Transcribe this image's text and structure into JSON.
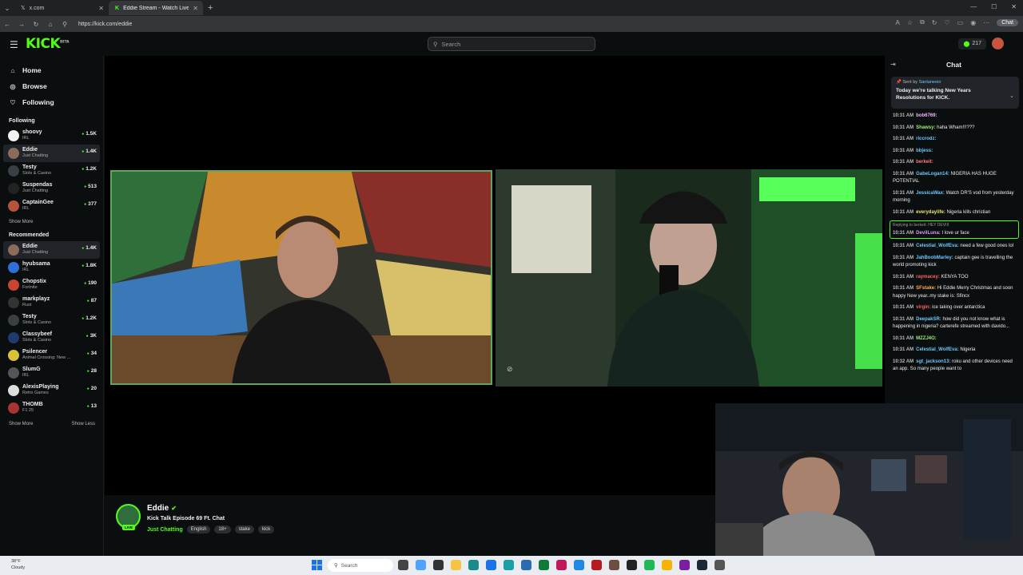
{
  "browser": {
    "tabs": [
      {
        "label": "x.com",
        "active": false
      },
      {
        "label": "Eddie Stream - Watch Live on",
        "active": true
      }
    ],
    "url": "https://kick.com/eddie",
    "chat_pill": "Chat"
  },
  "header": {
    "logo": "KICK",
    "logo_sup": "BETA",
    "search_placeholder": "Search",
    "viewer_count": "217"
  },
  "sidebar": {
    "nav": [
      {
        "label": "Home",
        "icon": "home-icon"
      },
      {
        "label": "Browse",
        "icon": "compass-icon"
      },
      {
        "label": "Following",
        "icon": "heart-icon"
      }
    ],
    "following_title": "Following",
    "following": [
      {
        "name": "shoovy",
        "category": "IRL",
        "viewers": "1.5K",
        "color": "#f2f2f2"
      },
      {
        "name": "Eddie",
        "category": "Just Chatting",
        "viewers": "1.4K",
        "color": "#8a6b5c",
        "selected": true
      },
      {
        "name": "Testy",
        "category": "Slots & Casino",
        "viewers": "1.2K",
        "color": "#3a3f46"
      },
      {
        "name": "Suspendas",
        "category": "Just Chatting",
        "viewers": "513",
        "color": "#222"
      },
      {
        "name": "CaptainGee",
        "category": "IRL",
        "viewers": "377",
        "color": "#b5543a"
      }
    ],
    "show_more_1": "Show More",
    "recommended_title": "Recommended",
    "recommended": [
      {
        "name": "Eddie",
        "category": "Just Chatting",
        "viewers": "1.4K",
        "color": "#8a6b5c",
        "selected": true
      },
      {
        "name": "hyubsama",
        "category": "IRL",
        "viewers": "1.8K",
        "color": "#2e6fd8"
      },
      {
        "name": "Chopstix",
        "category": "Fortnite",
        "viewers": "190",
        "color": "#c9452f"
      },
      {
        "name": "markplayz",
        "category": "Rust",
        "viewers": "87",
        "color": "#333"
      },
      {
        "name": "Testy",
        "category": "Slots & Casino",
        "viewers": "1.2K",
        "color": "#3a3f46"
      },
      {
        "name": "Classybeef",
        "category": "Slots & Casino",
        "viewers": "3K",
        "color": "#203a6e"
      },
      {
        "name": "Psilencer",
        "category": "Animal Crossing: New ...",
        "viewers": "34",
        "color": "#d7c23a"
      },
      {
        "name": "SlumG",
        "category": "IRL",
        "viewers": "28",
        "color": "#555"
      },
      {
        "name": "AlexisPlaying",
        "category": "Retro Games",
        "viewers": "20",
        "color": "#ddd"
      },
      {
        "name": "THOMB",
        "category": "F1 25",
        "viewers": "13",
        "color": "#a33"
      }
    ],
    "show_more_2": "Show More",
    "show_less": "Show Less"
  },
  "stream": {
    "name": "Eddie",
    "live_label": "LIVE",
    "title": "Kick Talk Episode 69 Ft. Chat",
    "category": "Just Chatting",
    "tags": [
      "English",
      "18+",
      "stake",
      "kick"
    ]
  },
  "chat": {
    "title": "Chat",
    "pinned_by_prefix": "Sent by",
    "pinned_by_user": "Santaneeio",
    "pinned_text": "Today we're talking New Years Resolutions for KICK.",
    "messages": [
      {
        "time": "10:31 AM",
        "user": "bob6769:",
        "color": "#f2b6ff",
        "text": ""
      },
      {
        "time": "10:31 AM",
        "user": "Shawsy:",
        "color": "#9ef07a",
        "text": "haha Wham!!!???"
      },
      {
        "time": "10:31 AM",
        "user": "riccrodz:",
        "color": "#6cc7ff",
        "text": ""
      },
      {
        "time": "10:31 AM",
        "user": "bbjess:",
        "color": "#6cc7ff",
        "text": ""
      },
      {
        "time": "10:31 AM",
        "user": "berkeit:",
        "color": "#ff7b7b",
        "text": ""
      },
      {
        "time": "10:31 AM",
        "user": "GabeLogan14:",
        "color": "#6cc7ff",
        "text": "NIGERIA HAS HUGE POTENTIAL"
      },
      {
        "time": "10:31 AM",
        "user": "JessicaWax:",
        "color": "#6cc7ff",
        "text": "Watch DR'S vod from yesterday morning"
      },
      {
        "time": "10:31 AM",
        "user": "everydaylife:",
        "color": "#f4e36b",
        "text": "Nigeria kills christian"
      },
      {
        "time": "10:31 AM",
        "user": "DevilLuna:",
        "color": "#d59bff",
        "text": "I love ur face",
        "reply": "Replying to berkeit: HEY DEVIII"
      },
      {
        "time": "10:31 AM",
        "user": "Celestial_WolfEva:",
        "color": "#6cc7ff",
        "text": "need a few good ones lol"
      },
      {
        "time": "10:31 AM",
        "user": "JahBoobMarley:",
        "color": "#6cc7ff",
        "text": "captain gee is travelling the world promoting kick"
      },
      {
        "time": "10:31 AM",
        "user": "raymacey:",
        "color": "#ff6262",
        "text": "KENYA TOO"
      },
      {
        "time": "10:31 AM",
        "user": "SFstake:",
        "color": "#ffb14a",
        "text": "Hi Eddie Merry Christmas and soon happy New year..my stake is: Sfincx"
      },
      {
        "time": "10:31 AM",
        "user": "virgin:",
        "color": "#ff6262",
        "text": "ice taking over antarctica"
      },
      {
        "time": "10:31 AM",
        "user": "DeepakSR:",
        "color": "#6cc7ff",
        "text": "how did you not know what is happening in nigeria? carterefe streamed with davido..."
      },
      {
        "time": "10:31 AM",
        "user": "MZZJ4O:",
        "color": "#9ef07a",
        "text": ""
      },
      {
        "time": "10:31 AM",
        "user": "Celestial_WolfEva:",
        "color": "#6cc7ff",
        "text": "Nigeria"
      },
      {
        "time": "10:32 AM",
        "user": "sgt_jackson13:",
        "color": "#6cc7ff",
        "text": "roku and other devices need an app. So many people want to"
      }
    ]
  },
  "taskbar": {
    "temp": "38°F",
    "weather": "Cloudy",
    "search": "Search"
  },
  "colors": {
    "accent": "#53fc18",
    "background": "#0b0e0f"
  }
}
